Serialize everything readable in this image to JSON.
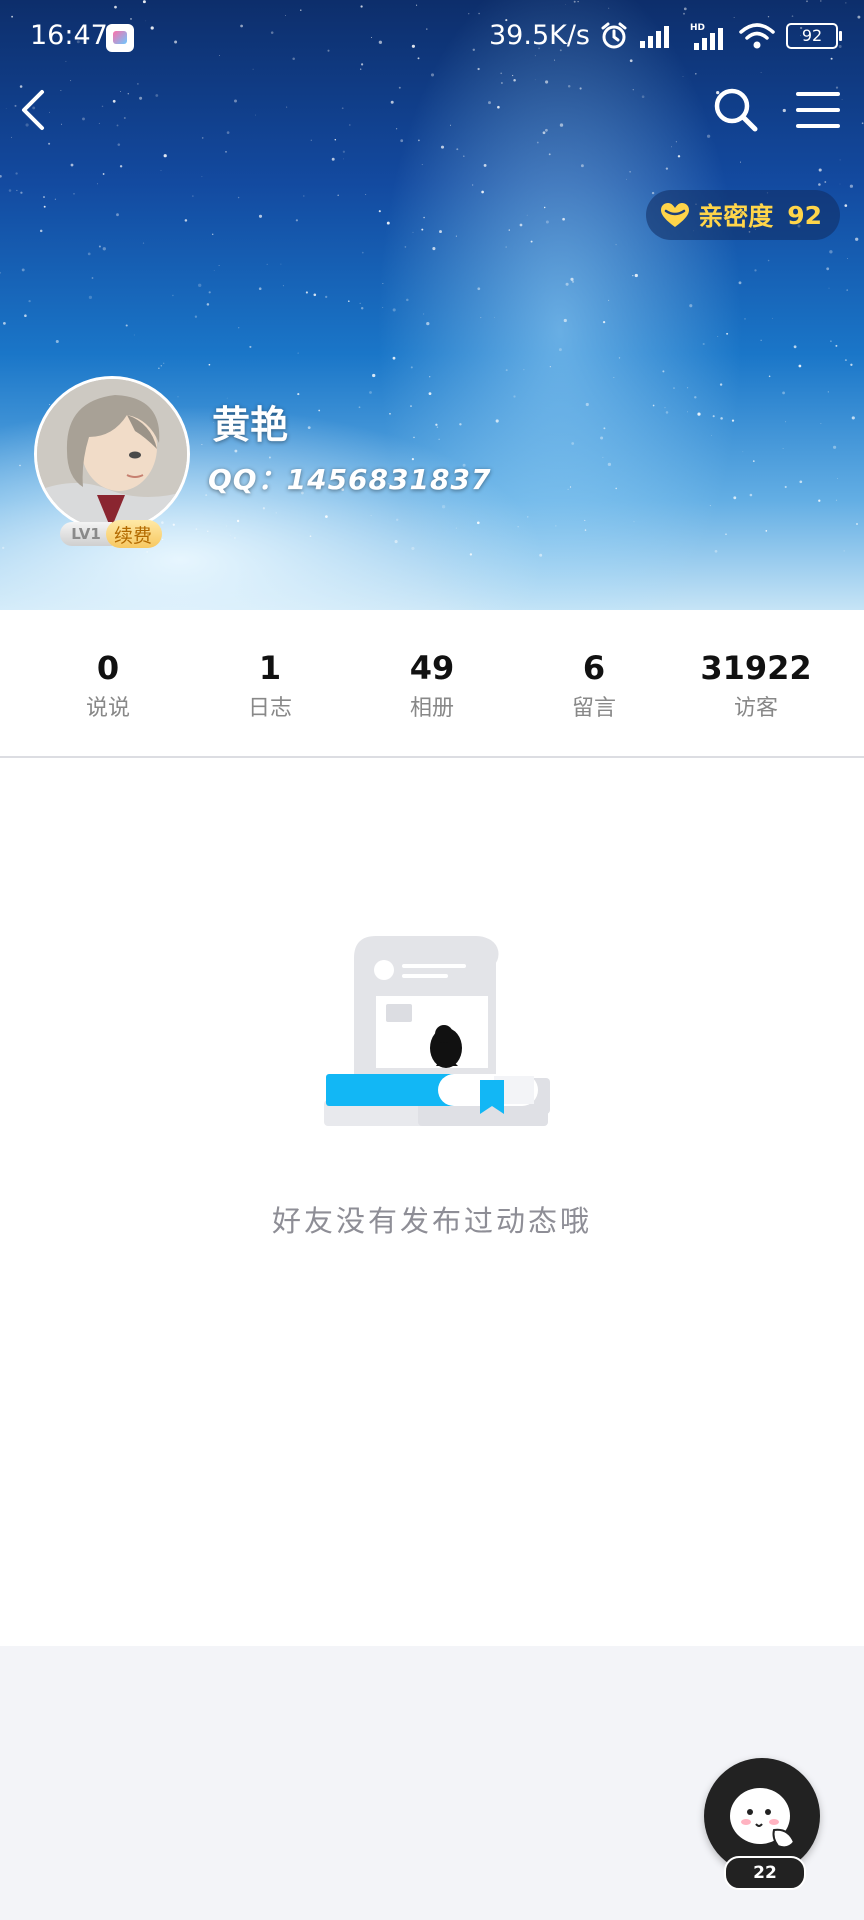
{
  "status_bar": {
    "time": "16:47",
    "net_speed": "39.5K/s",
    "battery": "92"
  },
  "nav": {
    "back_icon": "chevron-left-icon",
    "search_icon": "search-icon",
    "menu_icon": "hamburger-menu-icon"
  },
  "intimacy": {
    "label": "亲密度",
    "value": "92"
  },
  "profile": {
    "name": "黄艳",
    "qq_line": "QQ：1456831837",
    "level": "LV1",
    "renew_label": "续费"
  },
  "stats": [
    {
      "value": "0",
      "label": "说说"
    },
    {
      "value": "1",
      "label": "日志"
    },
    {
      "value": "49",
      "label": "相册"
    },
    {
      "value": "6",
      "label": "留言"
    },
    {
      "value": "31922",
      "label": "访客"
    }
  ],
  "empty_state": {
    "message": "好友没有发布过动态哦"
  },
  "floating": {
    "count": "22"
  },
  "colors": {
    "accent_blue": "#12b7f5",
    "intimacy_gold": "#ffd54a"
  }
}
